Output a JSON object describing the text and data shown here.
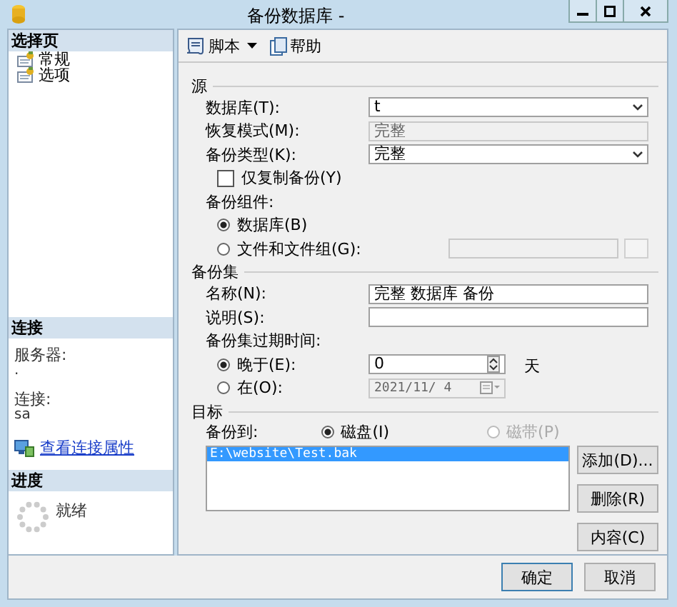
{
  "window": {
    "title": "备份数据库 -"
  },
  "sidebar": {
    "header": "选择页",
    "items": [
      {
        "label": "常规",
        "selected": false
      },
      {
        "label": "选项",
        "selected": false
      }
    ]
  },
  "connection": {
    "header": "连接",
    "server_label": "服务器:",
    "server": ".",
    "connection_label": "连接:",
    "connection": "sa",
    "link": "查看连接属性"
  },
  "progress": {
    "header": "进度",
    "status": "就绪"
  },
  "toolbar": [
    {
      "label": "脚本",
      "dropdown": true,
      "kind": "script"
    },
    {
      "label": "帮助",
      "dropdown": false,
      "kind": "help"
    }
  ],
  "source": {
    "title": "源",
    "database_label": "数据库(T):",
    "database": "t",
    "recovery_label": "恢复模式(M):",
    "recovery": "完整",
    "type_label": "备份类型(K):",
    "type": "完整",
    "copy_only": {
      "label": "仅复制备份(Y)",
      "checked": false
    },
    "component_label": "备份组件:",
    "components": [
      {
        "label": "数据库(B)",
        "selected": true
      },
      {
        "label": "文件和文件组(G):",
        "selected": false
      }
    ]
  },
  "backup_set": {
    "title": "备份集",
    "name_label": "名称(N):",
    "name": "完整 数据库 备份",
    "description_label": "说明(S):",
    "expire_label": "备份集过期时间:",
    "expire_options": [
      {
        "kind": "days",
        "label": "晚于(E):",
        "selected": true,
        "value": "0",
        "unit": "天"
      },
      {
        "kind": "date",
        "label": "在(O):",
        "selected": false,
        "value": "2021/11/ 4"
      }
    ]
  },
  "destination": {
    "title": "目标",
    "to_label": "备份到:",
    "media": [
      {
        "label": "磁盘(I)",
        "selected": true,
        "disabled": false
      },
      {
        "label": "磁带(P)",
        "selected": false,
        "disabled": true
      }
    ],
    "paths": [
      {
        "label": "E:\\website\\Test.bak",
        "selected": true
      }
    ],
    "buttons": [
      "添加(D)...",
      "删除(R)",
      "内容(C)"
    ]
  },
  "footer_buttons": [
    "确定",
    "取消"
  ]
}
